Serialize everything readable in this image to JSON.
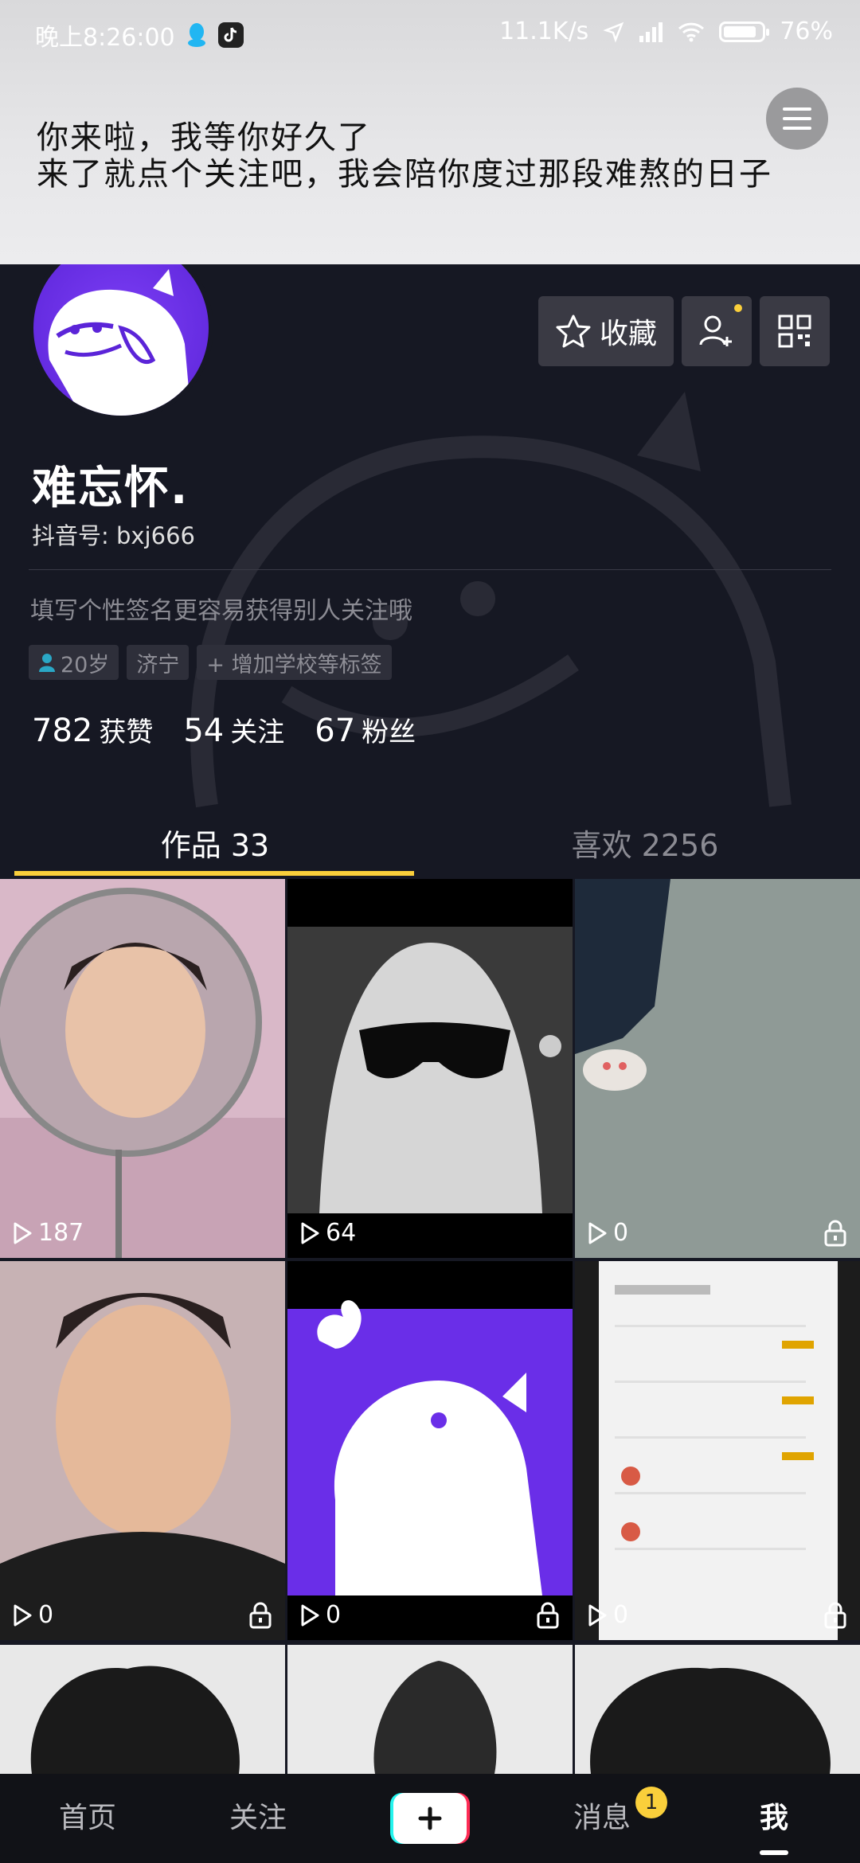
{
  "status_bar": {
    "time": "晚上8:26:00",
    "net_speed": "11.1K/s",
    "battery": "76%",
    "battery_level": 0.76
  },
  "banner": {
    "line1": "你来啦，我等你好久了",
    "line2": "来了就点个关注吧，我会陪你度过那段难熬的日子"
  },
  "profile": {
    "favorites_label": "收藏",
    "nickname": "难忘怀.",
    "douyin_id": "抖音号: bxj666",
    "signature": "填写个性签名更容易获得别人关注哦",
    "tags": {
      "age": "20岁",
      "city": "济宁",
      "add_school": "+ 增加学校等标签"
    },
    "stats": {
      "likes_num": "782",
      "likes_label": "获赞",
      "following_num": "54",
      "following_label": "关注",
      "followers_num": "67",
      "followers_label": "粉丝"
    }
  },
  "tabs": {
    "works": "作品 33",
    "likes": "喜欢 2256"
  },
  "videos": [
    {
      "plays": "187",
      "locked": false
    },
    {
      "plays": "64",
      "locked": false
    },
    {
      "plays": "0",
      "locked": true
    },
    {
      "plays": "0",
      "locked": true
    },
    {
      "plays": "0",
      "locked": true
    },
    {
      "plays": "0",
      "locked": true
    }
  ],
  "bottom_nav": {
    "home": "首页",
    "follow": "关注",
    "messages": "消息",
    "messages_badge": "1",
    "me": "我"
  },
  "colors": {
    "accent": "#facf3b",
    "background": "#161823",
    "avatar_purple": "#6a2ee8"
  }
}
